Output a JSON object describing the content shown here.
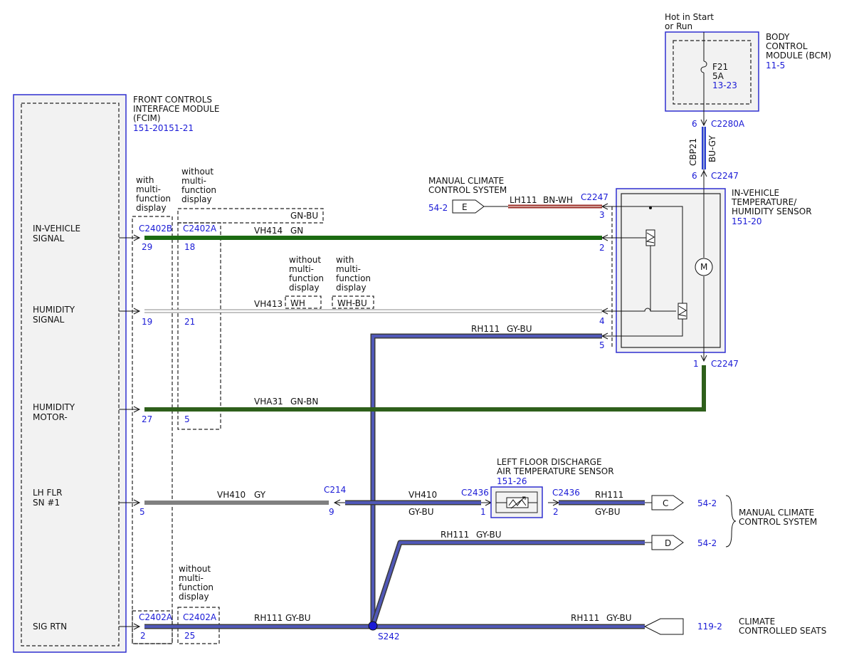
{
  "colors": {
    "blue_text": "#1a1ad6",
    "green": "#1c6b12",
    "dark_green": "#2e5f1b",
    "gray": "#808080",
    "gy_bu": "#5058b8",
    "bn_wh": "#9a2b25",
    "bu_gy": "#2b3fd0"
  },
  "fcim": {
    "title_lines": [
      "FRONT CONTROLS",
      "INTERFACE MODULE",
      "(FCIM)"
    ],
    "ref": "151-20151-21",
    "pins": {
      "in_vehicle": [
        "IN-VEHICLE",
        "SIGNAL"
      ],
      "humidity": [
        "HUMIDITY",
        "SIGNAL"
      ],
      "motor": [
        "HUMIDITY",
        "MOTOR-"
      ],
      "lh_flr": [
        "LH FLR",
        "SN #1"
      ],
      "sig_rtn": "SIG RTN"
    }
  },
  "notes": {
    "with_mfd": [
      "with",
      "multi-",
      "function",
      "display"
    ],
    "without_mfd": [
      "without",
      "multi-",
      "function",
      "display"
    ]
  },
  "bcm": {
    "source": [
      "Hot in Start",
      "or Run"
    ],
    "title_lines": [
      "BODY",
      "CONTROL",
      "MODULE (BCM)"
    ],
    "ref": "11-5",
    "fuse": "F21",
    "fuse_rating": "5A",
    "fuse_ref": "13-23"
  },
  "feed": {
    "c_top": "C2280A",
    "pin_top": "6",
    "circuit": "CBP21",
    "color": "BU-GY",
    "c_bottom": "C2247",
    "pin_bottom": "6"
  },
  "sensor": {
    "title_lines": [
      "IN-VEHICLE",
      "TEMPERATURE/",
      "HUMIDITY SENSOR"
    ],
    "ref": "151-20",
    "connector": "C2247",
    "pins": [
      "3",
      "2",
      "4",
      "5",
      "1"
    ],
    "motor_symbol": "M"
  },
  "mccs_top": {
    "title_lines": [
      "MANUAL CLIMATE",
      "CONTROL SYSTEM"
    ],
    "ref": "54-2",
    "flag": "E",
    "circuit": "LH111",
    "color": "BN-WH",
    "connector": "C2247"
  },
  "connectors": {
    "c2402b": "C2402B",
    "c2402a": "C2402A",
    "c214": "C214",
    "c2436": "C2436"
  },
  "wires": {
    "vh414": {
      "circuit": "VH414",
      "color": "GN",
      "alt_color": "GN-BU",
      "pin_b": "29",
      "pin_a": "18"
    },
    "vh413": {
      "circuit": "VH413",
      "color_without": "WH",
      "color_with": "WH-BU",
      "pin_b": "19",
      "pin_a": "21"
    },
    "rh111_top": {
      "circuit": "RH111",
      "color": "GY-BU"
    },
    "vha31": {
      "circuit": "VHA31",
      "color": "GN-BN",
      "pin_b": "27",
      "pin_a": "5"
    },
    "vh410": {
      "circuit": "VH410",
      "color": "GY",
      "pin": "5",
      "c214_pin": "9"
    },
    "vh410_right": {
      "circuit": "VH410",
      "color": "GY-BU",
      "pin": "1"
    },
    "rh111_c": {
      "circuit": "RH111",
      "color": "GY-BU",
      "pin": "2"
    },
    "rh111_d": {
      "circuit": "RH111",
      "color": "GY-BU"
    },
    "rh111_bottom": {
      "circuit": "RH111",
      "color": "GY-BU",
      "pin_a": "2",
      "pin_b": "25"
    },
    "rh111_seats": {
      "circuit": "RH111",
      "color": "GY-BU"
    }
  },
  "lfdat": {
    "title_lines": [
      "LEFT FLOOR DISCHARGE",
      "AIR TEMPERATURE SENSOR"
    ],
    "ref": "151-26"
  },
  "splice": "S242",
  "mccs_right": {
    "title_lines": [
      "MANUAL CLIMATE",
      "CONTROL SYSTEM"
    ],
    "flag_c": "C",
    "flag_d": "D",
    "ref_c": "54-2",
    "ref_d": "54-2"
  },
  "seats": {
    "title_lines": [
      "CLIMATE",
      "CONTROLLED SEATS"
    ],
    "ref": "119-2"
  }
}
